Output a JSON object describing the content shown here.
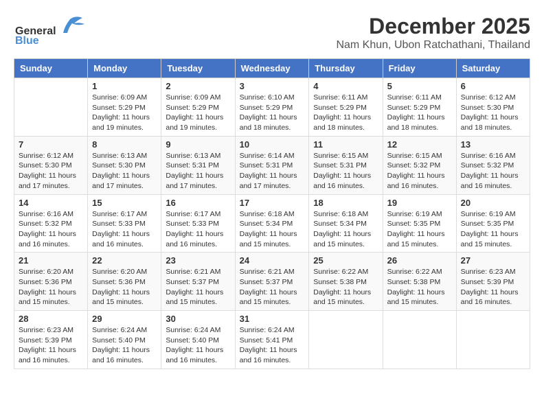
{
  "header": {
    "logo_general": "General",
    "logo_blue": "Blue",
    "month": "December 2025",
    "location": "Nam Khun, Ubon Ratchathani, Thailand"
  },
  "weekdays": [
    "Sunday",
    "Monday",
    "Tuesday",
    "Wednesday",
    "Thursday",
    "Friday",
    "Saturday"
  ],
  "weeks": [
    [
      {
        "day": "",
        "sunrise": "",
        "sunset": "",
        "daylight": ""
      },
      {
        "day": "1",
        "sunrise": "Sunrise: 6:09 AM",
        "sunset": "Sunset: 5:29 PM",
        "daylight": "Daylight: 11 hours and 19 minutes."
      },
      {
        "day": "2",
        "sunrise": "Sunrise: 6:09 AM",
        "sunset": "Sunset: 5:29 PM",
        "daylight": "Daylight: 11 hours and 19 minutes."
      },
      {
        "day": "3",
        "sunrise": "Sunrise: 6:10 AM",
        "sunset": "Sunset: 5:29 PM",
        "daylight": "Daylight: 11 hours and 18 minutes."
      },
      {
        "day": "4",
        "sunrise": "Sunrise: 6:11 AM",
        "sunset": "Sunset: 5:29 PM",
        "daylight": "Daylight: 11 hours and 18 minutes."
      },
      {
        "day": "5",
        "sunrise": "Sunrise: 6:11 AM",
        "sunset": "Sunset: 5:29 PM",
        "daylight": "Daylight: 11 hours and 18 minutes."
      },
      {
        "day": "6",
        "sunrise": "Sunrise: 6:12 AM",
        "sunset": "Sunset: 5:30 PM",
        "daylight": "Daylight: 11 hours and 18 minutes."
      }
    ],
    [
      {
        "day": "7",
        "sunrise": "Sunrise: 6:12 AM",
        "sunset": "Sunset: 5:30 PM",
        "daylight": "Daylight: 11 hours and 17 minutes."
      },
      {
        "day": "8",
        "sunrise": "Sunrise: 6:13 AM",
        "sunset": "Sunset: 5:30 PM",
        "daylight": "Daylight: 11 hours and 17 minutes."
      },
      {
        "day": "9",
        "sunrise": "Sunrise: 6:13 AM",
        "sunset": "Sunset: 5:31 PM",
        "daylight": "Daylight: 11 hours and 17 minutes."
      },
      {
        "day": "10",
        "sunrise": "Sunrise: 6:14 AM",
        "sunset": "Sunset: 5:31 PM",
        "daylight": "Daylight: 11 hours and 17 minutes."
      },
      {
        "day": "11",
        "sunrise": "Sunrise: 6:15 AM",
        "sunset": "Sunset: 5:31 PM",
        "daylight": "Daylight: 11 hours and 16 minutes."
      },
      {
        "day": "12",
        "sunrise": "Sunrise: 6:15 AM",
        "sunset": "Sunset: 5:32 PM",
        "daylight": "Daylight: 11 hours and 16 minutes."
      },
      {
        "day": "13",
        "sunrise": "Sunrise: 6:16 AM",
        "sunset": "Sunset: 5:32 PM",
        "daylight": "Daylight: 11 hours and 16 minutes."
      }
    ],
    [
      {
        "day": "14",
        "sunrise": "Sunrise: 6:16 AM",
        "sunset": "Sunset: 5:32 PM",
        "daylight": "Daylight: 11 hours and 16 minutes."
      },
      {
        "day": "15",
        "sunrise": "Sunrise: 6:17 AM",
        "sunset": "Sunset: 5:33 PM",
        "daylight": "Daylight: 11 hours and 16 minutes."
      },
      {
        "day": "16",
        "sunrise": "Sunrise: 6:17 AM",
        "sunset": "Sunset: 5:33 PM",
        "daylight": "Daylight: 11 hours and 16 minutes."
      },
      {
        "day": "17",
        "sunrise": "Sunrise: 6:18 AM",
        "sunset": "Sunset: 5:34 PM",
        "daylight": "Daylight: 11 hours and 15 minutes."
      },
      {
        "day": "18",
        "sunrise": "Sunrise: 6:18 AM",
        "sunset": "Sunset: 5:34 PM",
        "daylight": "Daylight: 11 hours and 15 minutes."
      },
      {
        "day": "19",
        "sunrise": "Sunrise: 6:19 AM",
        "sunset": "Sunset: 5:35 PM",
        "daylight": "Daylight: 11 hours and 15 minutes."
      },
      {
        "day": "20",
        "sunrise": "Sunrise: 6:19 AM",
        "sunset": "Sunset: 5:35 PM",
        "daylight": "Daylight: 11 hours and 15 minutes."
      }
    ],
    [
      {
        "day": "21",
        "sunrise": "Sunrise: 6:20 AM",
        "sunset": "Sunset: 5:36 PM",
        "daylight": "Daylight: 11 hours and 15 minutes."
      },
      {
        "day": "22",
        "sunrise": "Sunrise: 6:20 AM",
        "sunset": "Sunset: 5:36 PM",
        "daylight": "Daylight: 11 hours and 15 minutes."
      },
      {
        "day": "23",
        "sunrise": "Sunrise: 6:21 AM",
        "sunset": "Sunset: 5:37 PM",
        "daylight": "Daylight: 11 hours and 15 minutes."
      },
      {
        "day": "24",
        "sunrise": "Sunrise: 6:21 AM",
        "sunset": "Sunset: 5:37 PM",
        "daylight": "Daylight: 11 hours and 15 minutes."
      },
      {
        "day": "25",
        "sunrise": "Sunrise: 6:22 AM",
        "sunset": "Sunset: 5:38 PM",
        "daylight": "Daylight: 11 hours and 15 minutes."
      },
      {
        "day": "26",
        "sunrise": "Sunrise: 6:22 AM",
        "sunset": "Sunset: 5:38 PM",
        "daylight": "Daylight: 11 hours and 15 minutes."
      },
      {
        "day": "27",
        "sunrise": "Sunrise: 6:23 AM",
        "sunset": "Sunset: 5:39 PM",
        "daylight": "Daylight: 11 hours and 16 minutes."
      }
    ],
    [
      {
        "day": "28",
        "sunrise": "Sunrise: 6:23 AM",
        "sunset": "Sunset: 5:39 PM",
        "daylight": "Daylight: 11 hours and 16 minutes."
      },
      {
        "day": "29",
        "sunrise": "Sunrise: 6:24 AM",
        "sunset": "Sunset: 5:40 PM",
        "daylight": "Daylight: 11 hours and 16 minutes."
      },
      {
        "day": "30",
        "sunrise": "Sunrise: 6:24 AM",
        "sunset": "Sunset: 5:40 PM",
        "daylight": "Daylight: 11 hours and 16 minutes."
      },
      {
        "day": "31",
        "sunrise": "Sunrise: 6:24 AM",
        "sunset": "Sunset: 5:41 PM",
        "daylight": "Daylight: 11 hours and 16 minutes."
      },
      {
        "day": "",
        "sunrise": "",
        "sunset": "",
        "daylight": ""
      },
      {
        "day": "",
        "sunrise": "",
        "sunset": "",
        "daylight": ""
      },
      {
        "day": "",
        "sunrise": "",
        "sunset": "",
        "daylight": ""
      }
    ]
  ]
}
